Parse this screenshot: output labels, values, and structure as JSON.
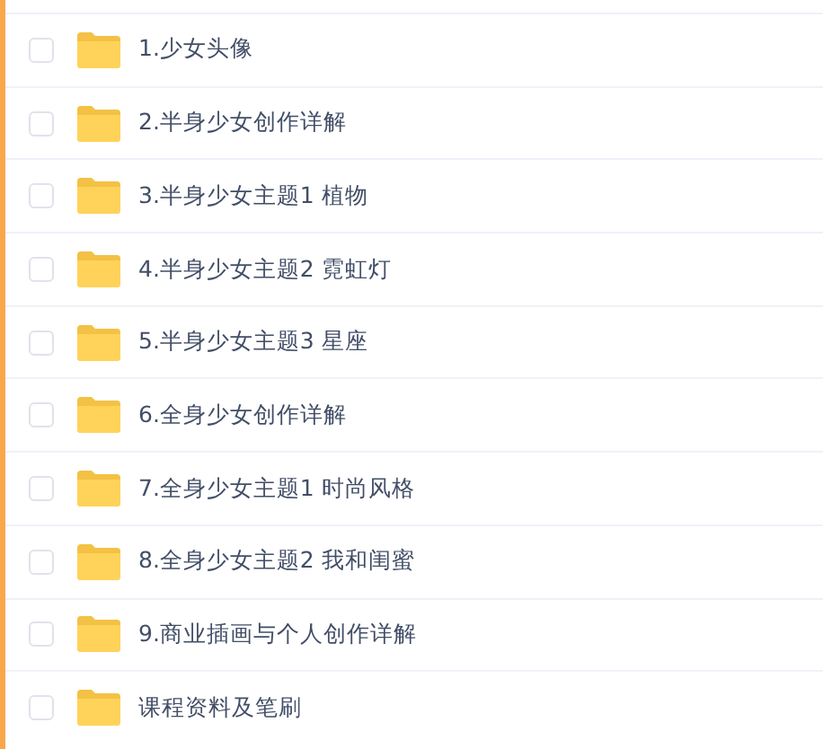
{
  "files": [
    {
      "name": "1.少女头像",
      "checked": false
    },
    {
      "name": "2.半身少女创作详解",
      "checked": false
    },
    {
      "name": "3.半身少女主题1 植物",
      "checked": false
    },
    {
      "name": "4.半身少女主题2 霓虹灯",
      "checked": false
    },
    {
      "name": "5.半身少女主题3 星座",
      "checked": false
    },
    {
      "name": "6.全身少女创作详解",
      "checked": false
    },
    {
      "name": "7.全身少女主题1 时尚风格",
      "checked": false
    },
    {
      "name": "8.全身少女主题2 我和闺蜜",
      "checked": false
    },
    {
      "name": "9.商业插画与个人创作详解",
      "checked": false
    },
    {
      "name": "课程资料及笔刷",
      "checked": false
    }
  ]
}
